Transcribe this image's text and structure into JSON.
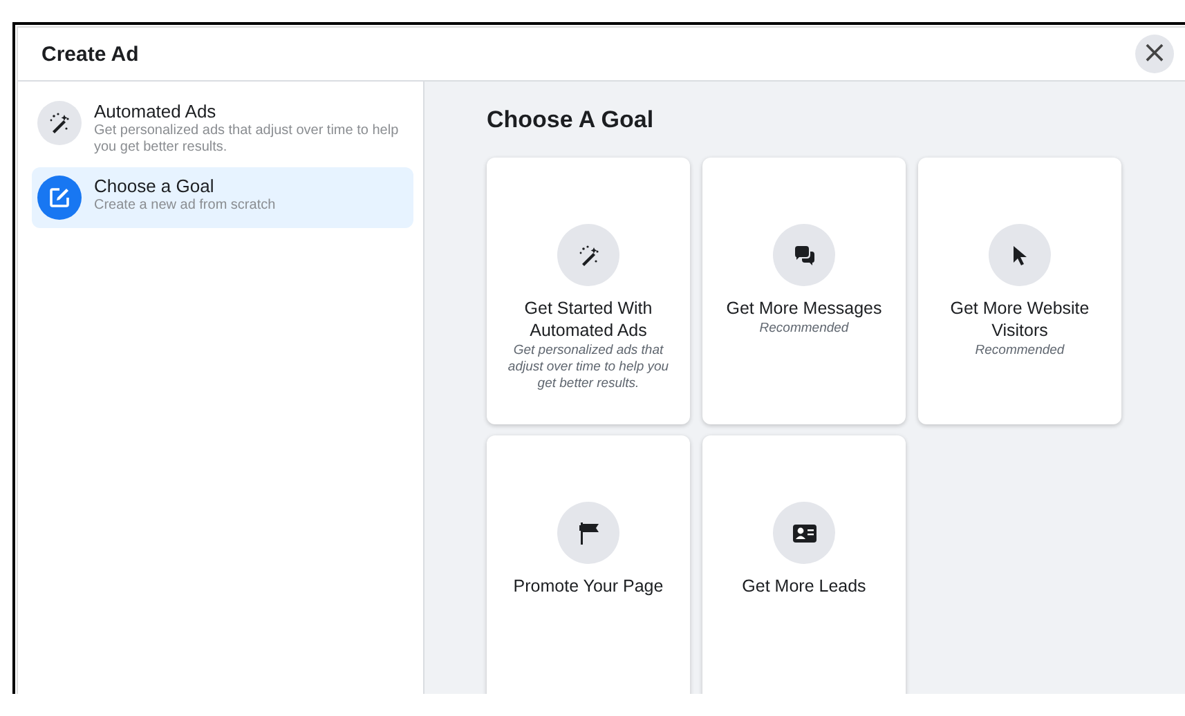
{
  "dialog": {
    "title": "Create Ad",
    "close_label": "×"
  },
  "sidebar": {
    "items": [
      {
        "title": "Automated Ads",
        "description": "Get personalized ads that adjust over time to help you get better results.",
        "selected": false
      },
      {
        "title": "Choose a Goal",
        "description": "Create a new ad from scratch",
        "selected": true
      }
    ]
  },
  "main": {
    "heading": "Choose A Goal",
    "goals": [
      {
        "title": "Get Started With Automated Ads",
        "note": "Get personalized ads that adjust over time to help you get better results."
      },
      {
        "title": "Get More Messages",
        "note": "Recommended"
      },
      {
        "title": "Get More Website Visitors",
        "note": "Recommended"
      },
      {
        "title": "Promote Your Page"
      },
      {
        "title": "Get More Leads"
      }
    ]
  }
}
